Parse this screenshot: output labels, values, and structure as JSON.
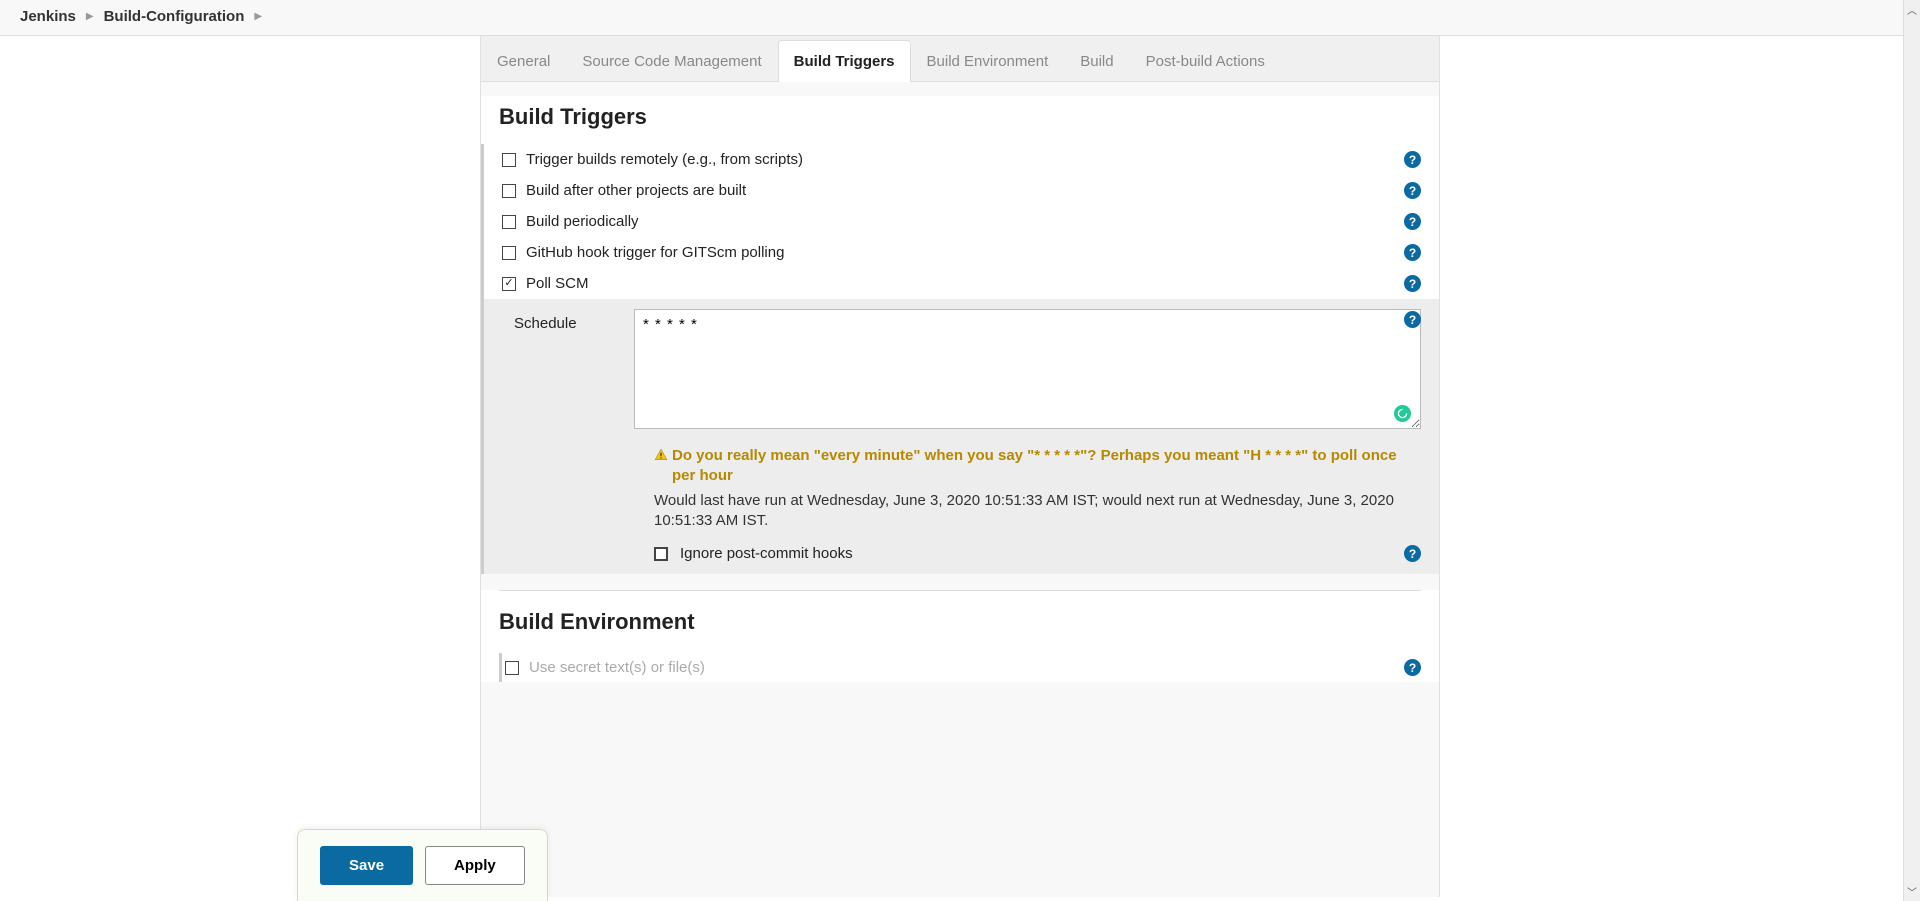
{
  "breadcrumbs": {
    "root": "Jenkins",
    "job": "Build-Configuration"
  },
  "tabs": {
    "general": "General",
    "scm": "Source Code Management",
    "triggers": "Build Triggers",
    "env": "Build Environment",
    "build": "Build",
    "post": "Post-build Actions"
  },
  "triggers": {
    "title": "Build Triggers",
    "remote": "Trigger builds remotely (e.g., from scripts)",
    "after": "Build after other projects are built",
    "periodic": "Build periodically",
    "github": "GitHub hook trigger for GITScm polling",
    "poll": "Poll SCM",
    "schedule_label": "Schedule",
    "schedule_value": "* * * * *",
    "warning": "Do you really mean \"every minute\" when you say \"* * * * *\"? Perhaps you meant \"H * * * *\" to poll once per hour",
    "info": "Would last have run at Wednesday, June 3, 2020 10:51:33 AM IST; would next run at Wednesday, June 3, 2020 10:51:33 AM IST.",
    "ignore": "Ignore post-commit hooks"
  },
  "env": {
    "title": "Build Environment",
    "secret": "Use secret text(s) or file(s)"
  },
  "buttons": {
    "save": "Save",
    "apply": "Apply"
  },
  "help_glyph": "?"
}
